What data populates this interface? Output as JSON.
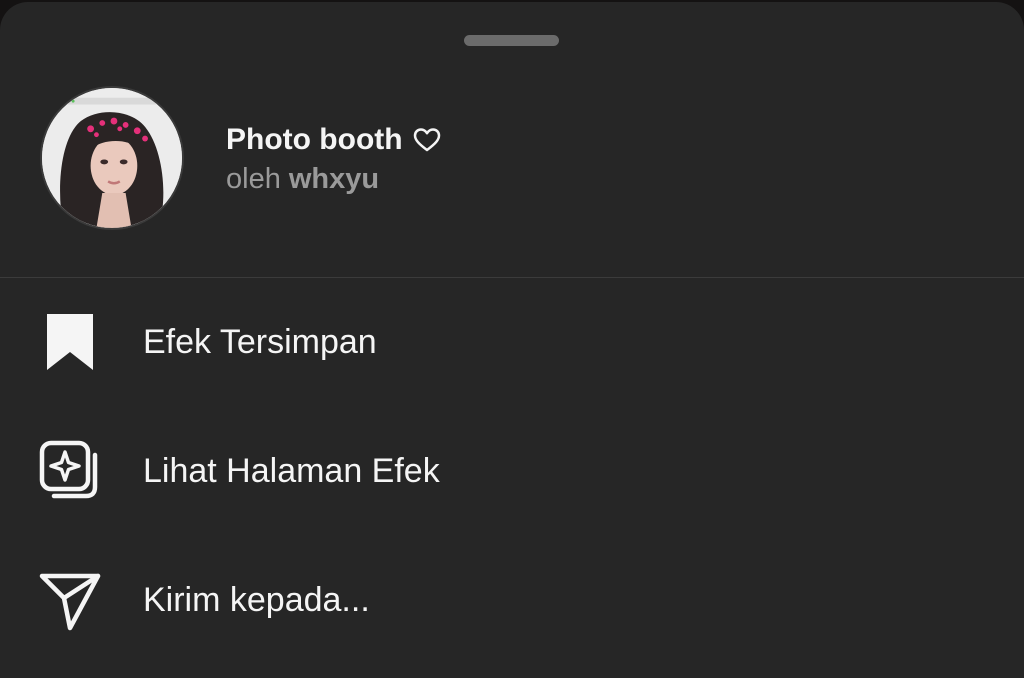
{
  "effect": {
    "title": "Photo booth",
    "by_prefix": "oleh",
    "author": "whxyu"
  },
  "menu": {
    "items": [
      {
        "label": "Efek Tersimpan",
        "icon": "bookmark-icon"
      },
      {
        "label": "Lihat Halaman Efek",
        "icon": "effects-page-icon"
      },
      {
        "label": "Kirim kepada...",
        "icon": "send-icon"
      }
    ]
  },
  "colors": {
    "sheet_bg": "#262626",
    "text_primary": "#f5f5f5",
    "text_secondary": "#9a9a9a",
    "divider": "#3b3b3b"
  }
}
